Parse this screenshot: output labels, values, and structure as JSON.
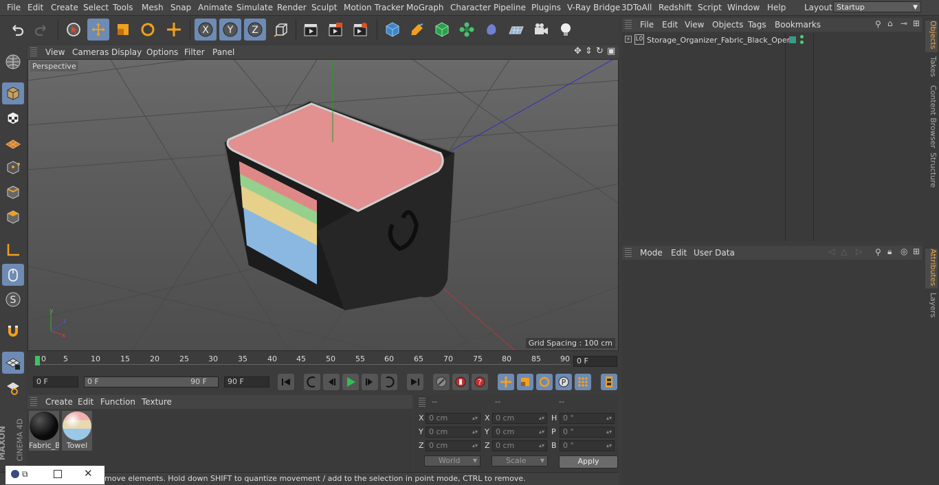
{
  "menubar": {
    "items": [
      "File",
      "Edit",
      "Create",
      "Select",
      "Tools",
      "Mesh",
      "Snap",
      "Animate",
      "Simulate",
      "Render",
      "Sculpt",
      "Motion Tracker",
      "MoGraph",
      "Character",
      "Pipeline",
      "Plugins",
      "V-Ray Bridge",
      "3DToAll",
      "Redshift",
      "Script",
      "Window",
      "Help"
    ],
    "layout_label": "Layout:",
    "layout_value": "Startup"
  },
  "viewport": {
    "menu": [
      "View",
      "Cameras",
      "Display",
      "Options",
      "Filter",
      "Panel"
    ],
    "label": "Perspective",
    "grid_spacing": "Grid Spacing : 100 cm"
  },
  "timeline": {
    "ticks": [
      "0",
      "5",
      "10",
      "15",
      "20",
      "25",
      "30",
      "35",
      "40",
      "45",
      "50",
      "55",
      "60",
      "65",
      "70",
      "75",
      "80",
      "85",
      "90"
    ],
    "current_frame": "0 F"
  },
  "playback": {
    "start": "0 F",
    "range_start": "0 F",
    "range_end": "90 F",
    "end": "90 F"
  },
  "materials": {
    "menu": [
      "Create",
      "Edit",
      "Function",
      "Texture"
    ],
    "items": [
      {
        "name": "Fabric_B"
      },
      {
        "name": "Towel"
      }
    ]
  },
  "coordinates": {
    "headers": [
      "--",
      "--",
      "--"
    ],
    "rows": [
      {
        "l1": "X",
        "v1": "0 cm",
        "l2": "X",
        "v2": "0 cm",
        "l3": "H",
        "v3": "0 °"
      },
      {
        "l1": "Y",
        "v1": "0 cm",
        "l2": "Y",
        "v2": "0 cm",
        "l3": "P",
        "v3": "0 °"
      },
      {
        "l1": "Z",
        "v1": "0 cm",
        "l2": "Z",
        "v2": "0 cm",
        "l3": "B",
        "v3": "0 °"
      }
    ],
    "space": "World",
    "mode": "Scale",
    "apply": "Apply"
  },
  "status": "move elements. Hold down SHIFT to quantize movement / add to the selection in point mode, CTRL to remove.",
  "objects": {
    "menu": [
      "File",
      "Edit",
      "View",
      "Objects",
      "Tags",
      "Bookmarks"
    ],
    "items": [
      {
        "name": "Storage_Organizer_Fabric_Black_Open"
      }
    ]
  },
  "attributes": {
    "menu": [
      "Mode",
      "Edit",
      "User Data"
    ]
  },
  "right_tabs": [
    "Objects",
    "Takes",
    "Content Browser",
    "Structure",
    "Attributes",
    "Layers"
  ],
  "colors": {
    "accent": "#6d8bb4",
    "active_tab": "#e9a84a"
  }
}
